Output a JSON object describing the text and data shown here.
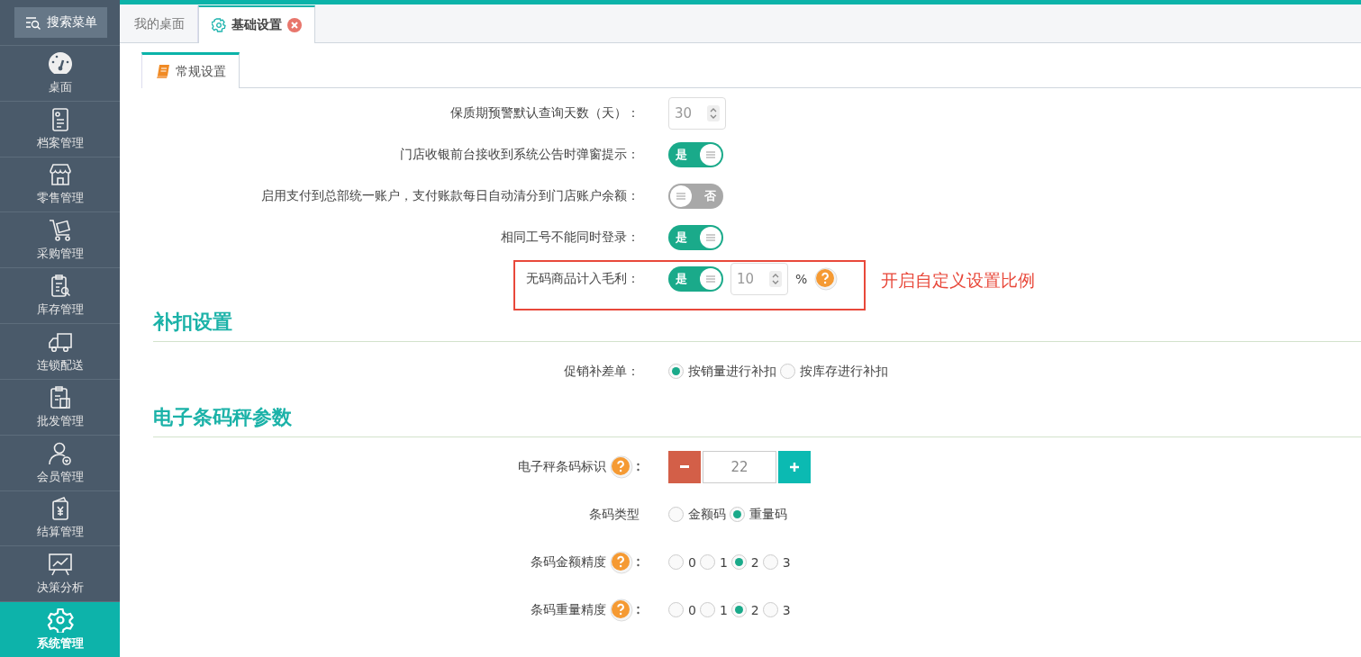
{
  "sidebar": {
    "search_button": "搜索菜单",
    "items": [
      {
        "label": "桌面",
        "selected": false
      },
      {
        "label": "档案管理",
        "selected": false
      },
      {
        "label": "零售管理",
        "selected": false
      },
      {
        "label": "采购管理",
        "selected": false
      },
      {
        "label": "库存管理",
        "selected": false
      },
      {
        "label": "连锁配送",
        "selected": false
      },
      {
        "label": "批发管理",
        "selected": false
      },
      {
        "label": "会员管理",
        "selected": false
      },
      {
        "label": "结算管理",
        "selected": false
      },
      {
        "label": "决策分析",
        "selected": false
      },
      {
        "label": "系统管理",
        "selected": true
      }
    ]
  },
  "tabs": [
    {
      "label": "我的桌面",
      "selected": false,
      "closable": false
    },
    {
      "label": "基础设置",
      "selected": true,
      "closable": true
    }
  ],
  "subtabs": [
    {
      "label": "常规设置",
      "selected": true
    }
  ],
  "general": [
    {
      "kind": "number",
      "label": "保质期预警默认查询天数（天）：",
      "value": "30"
    },
    {
      "kind": "toggle",
      "label": "门店收银前台接收到系统公告时弹窗提示：",
      "on": true,
      "text": "是"
    },
    {
      "kind": "toggle",
      "label": "启用支付到总部统一账户，支付账款每日自动清分到门店账户余额：",
      "on": false,
      "text": "否"
    },
    {
      "kind": "toggle",
      "label": "相同工号不能同时登录：",
      "on": true,
      "text": "是"
    },
    {
      "kind": "toggle_percent",
      "label": "无码商品计入毛利：",
      "on": true,
      "text": "是",
      "value": "10",
      "unit": "%",
      "highlighted": true,
      "annotation": "开启自定义设置比例"
    }
  ],
  "sections": [
    {
      "title": "补扣设置",
      "rows": [
        {
          "kind": "radio",
          "label": "促销补差单：",
          "help": false,
          "options": [
            {
              "label": "按销量进行补扣",
              "selected": true
            },
            {
              "label": "按库存进行补扣",
              "selected": false
            }
          ]
        }
      ]
    },
    {
      "title": "电子条码秤参数",
      "rows": [
        {
          "kind": "stepper",
          "label": "电子秤条码标识",
          "help": true,
          "value": "22"
        },
        {
          "kind": "radio",
          "label": "条码类型",
          "help": false,
          "options": [
            {
              "label": "金额码",
              "selected": false
            },
            {
              "label": "重量码",
              "selected": true
            }
          ]
        },
        {
          "kind": "radio",
          "label": "条码金额精度",
          "help": true,
          "options": [
            {
              "label": "0",
              "selected": false
            },
            {
              "label": "1",
              "selected": false
            },
            {
              "label": "2",
              "selected": true
            },
            {
              "label": "3",
              "selected": false
            }
          ]
        },
        {
          "kind": "radio",
          "label": "条码重量精度",
          "help": true,
          "options": [
            {
              "label": "0",
              "selected": false
            },
            {
              "label": "1",
              "selected": false
            },
            {
              "label": "2",
              "selected": true
            },
            {
              "label": "3",
              "selected": false
            }
          ]
        }
      ]
    }
  ]
}
